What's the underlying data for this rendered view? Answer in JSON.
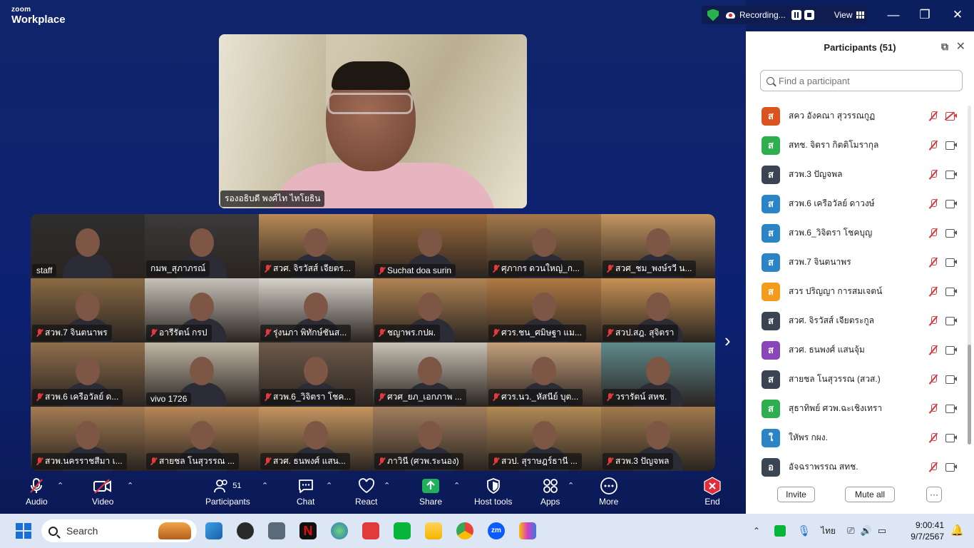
{
  "app": {
    "brand_top": "zoom",
    "brand_bottom": "Workplace"
  },
  "recording": {
    "label": "Recording...",
    "view_label": "View"
  },
  "window_controls": {
    "minimize": "—",
    "maximize": "❐",
    "close": "✕"
  },
  "speaker": {
    "name": "รองอธิบดี พงศ์ไท ไทโยธิน"
  },
  "gallery": [
    {
      "name": "staff",
      "muted": false,
      "bg": "#2e2e2e"
    },
    {
      "name": "กมพ_สุภาภรณ์",
      "muted": false,
      "bg": "#3b3a3a"
    },
    {
      "name": "สวศ. จิรวัสส์ เจียตร...",
      "muted": true,
      "bg": "#b88a56"
    },
    {
      "name": "Suchat doa surin",
      "muted": true,
      "bg": "#9b6a3a"
    },
    {
      "name": "ศุภากร ดวนใหญ่_ก...",
      "muted": true,
      "bg": "#a3784b"
    },
    {
      "name": "สวศ_ชม_พงษ์รวี น...",
      "muted": true,
      "bg": "#c49660"
    },
    {
      "name": "สวพ.7 จินตนาพร",
      "muted": true,
      "bg": "#8a6a44"
    },
    {
      "name": "อารีรัตน์ กรป",
      "muted": true,
      "bg": "#c7c2b9"
    },
    {
      "name": "รุ่งนภา พิทักษ์ชันส...",
      "muted": true,
      "bg": "#d6d2ca"
    },
    {
      "name": "ชญาพร.กปผ.",
      "muted": true,
      "bg": "#b08354"
    },
    {
      "name": "ศวร.ชน_ศมิษฐา แม...",
      "muted": true,
      "bg": "#b07a44"
    },
    {
      "name": "สวป.สฎ. สุจิตรา",
      "muted": true,
      "bg": "#c69154"
    },
    {
      "name": "สวพ.6 เครือวัลย์ ด...",
      "muted": true,
      "bg": "#8f6e4d"
    },
    {
      "name": "vivo 1726",
      "muted": false,
      "bg": "#bfb6a4"
    },
    {
      "name": "สวพ.6_วิจิตรา โชค...",
      "muted": true,
      "bg": "#6d5a4a"
    },
    {
      "name": "ศวศ_ยภ_เอกภาพ ...",
      "muted": true,
      "bg": "#c9c2b6"
    },
    {
      "name": "ศวร.นว._หัสนีย์ บุต...",
      "muted": true,
      "bg": "#c4a07c"
    },
    {
      "name": "วรารัตน์ สหช.",
      "muted": true,
      "bg": "#5f8a8d"
    },
    {
      "name": "สวพ.นครราชสีมา เ...",
      "muted": true,
      "bg": "#a37b52"
    },
    {
      "name": "สายชล โนสุวรรณ ...",
      "muted": true,
      "bg": "#b68758"
    },
    {
      "name": "สวศ. ธนพงศ์ แสน...",
      "muted": true,
      "bg": "#c49560"
    },
    {
      "name": "ภาวินี (ศวพ.ระนอง)",
      "muted": true,
      "bg": "#a27f5d"
    },
    {
      "name": "สวป. สุราษฎร์ธานี ...",
      "muted": true,
      "bg": "#b28a55"
    },
    {
      "name": "สวพ.3 ปัญจพล",
      "muted": true,
      "bg": "#a17a4d"
    }
  ],
  "toolbar": {
    "audio": "Audio",
    "video": "Video",
    "participants": "Participants",
    "participants_count": "51",
    "chat": "Chat",
    "react": "React",
    "share": "Share",
    "host_tools": "Host tools",
    "apps": "Apps",
    "more": "More",
    "end": "End"
  },
  "panel": {
    "title": "Participants (51)",
    "search_placeholder": "Find a participant",
    "participants": [
      {
        "initial": "ส",
        "name": "สคว อังคณา สุวรรณกูฏ",
        "color": "#d9541e",
        "video_off": true
      },
      {
        "initial": "ส",
        "name": "สทช. จิตรา กิตติโมรากุล",
        "color": "#2fae4f",
        "video_off": false
      },
      {
        "initial": "ส",
        "name": "สวพ.3 ปัญจพล",
        "color": "#3b4452",
        "video_off": false
      },
      {
        "initial": "ส",
        "name": "สวพ.6 เครือวัลย์ ดาวงษ์",
        "color": "#2a84c6",
        "video_off": false
      },
      {
        "initial": "ส",
        "name": "สวพ.6_วิจิตรา โชคบุญ",
        "color": "#2a84c6",
        "video_off": false
      },
      {
        "initial": "ส",
        "name": "สวพ.7 จินตนาพร",
        "color": "#2a84c6",
        "video_off": false
      },
      {
        "initial": "ส",
        "name": "สวร ปริญญา การสมเจตน์",
        "color": "#f29b1d",
        "video_off": false
      },
      {
        "initial": "ส",
        "name": "สวศ. จิรวัสส์ เจียตระกูล",
        "color": "#3b4452",
        "video_off": false
      },
      {
        "initial": "ส",
        "name": "สวศ. ธนพงศ์ แสนจุ้ม",
        "color": "#8a45b8",
        "video_off": false
      },
      {
        "initial": "ส",
        "name": "สายชล โนสุวรรณ (สวส.)",
        "color": "#3b4452",
        "video_off": false
      },
      {
        "initial": "ส",
        "name": "สุธาทิพย์ ศวพ.ฉะเชิงเทรา",
        "color": "#2fae4f",
        "video_off": false
      },
      {
        "initial": "ใ",
        "name": "ใหัพร กผง.",
        "color": "#2a84c6",
        "video_off": false
      },
      {
        "initial": "อ",
        "name": "อัจฉราพรรณ สทช.",
        "color": "#3b4452",
        "video_off": false
      }
    ],
    "invite": "Invite",
    "mute_all": "Mute all",
    "more": "···"
  },
  "taskbar": {
    "search": "Search",
    "lang": "ไทย",
    "time": "9:00:41",
    "date": "9/7/2567"
  }
}
